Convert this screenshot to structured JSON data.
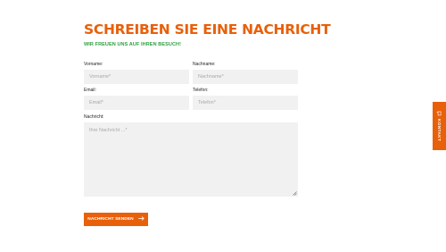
{
  "form": {
    "title": "SCHREIBEN SIE EINE NACHRICHT",
    "subtitle": "WIR FREUEN UNS AUF IHREN BESUCH!",
    "fields": {
      "vorname": {
        "label": "Vorname:",
        "placeholder": "Vorname*"
      },
      "nachname": {
        "label": "Nachname:",
        "placeholder": "Nachname*"
      },
      "email": {
        "label": "Email:",
        "placeholder": "Email*"
      },
      "telefon": {
        "label": "Telefon:",
        "placeholder": "Telefon*"
      },
      "nachricht": {
        "label": "Nachricht:",
        "placeholder": "Ihre Nachricht ...*"
      }
    },
    "submit_label": "NACHRICHT SENDEN",
    "submit_icon": "arrow-right-icon"
  },
  "sidebar_tab": {
    "label": "KONTAKT",
    "icon": "chat-icon"
  },
  "colors": {
    "accent": "#e8600a",
    "subtitle": "#2e9e3e",
    "input_bg": "#f1f1f1"
  }
}
